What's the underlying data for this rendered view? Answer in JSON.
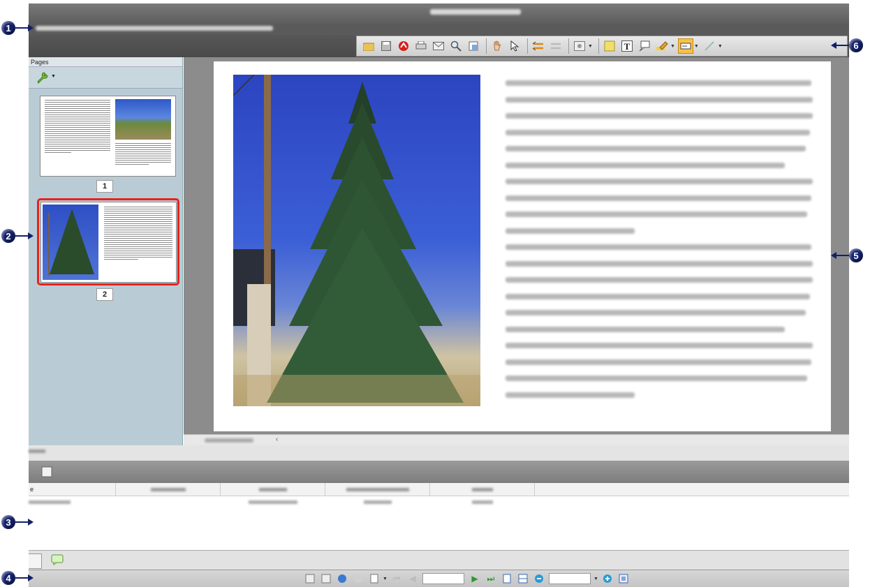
{
  "annotations": [
    {
      "num": "1",
      "label": "1"
    },
    {
      "num": "2",
      "label": "2"
    },
    {
      "num": "3",
      "label": "3"
    },
    {
      "num": "4",
      "label": "4"
    },
    {
      "num": "5",
      "label": "5"
    },
    {
      "num": "6",
      "label": "6"
    }
  ],
  "pages_panel": {
    "title": "Pages",
    "thumbnails": [
      {
        "page_number": "1",
        "selected": false
      },
      {
        "page_number": "2",
        "selected": true
      }
    ]
  },
  "bottom_panel": {
    "first_column_header": "e"
  },
  "toolbar_icons": [
    "open-folder-icon",
    "save-icon",
    "pdf-icon",
    "print-icon",
    "email-icon",
    "search-icon",
    "find-replace-icon",
    "hand-tool-icon",
    "select-tool-icon",
    "prev-view-icon",
    "next-view-icon",
    "page-options-icon",
    "note-icon",
    "text-tool-icon",
    "callout-icon",
    "highlighter-icon",
    "form-field-icon",
    "pen-icon"
  ],
  "colors": {
    "selection": "#e8211b",
    "accent": "#f7c24b",
    "marker": "#12206a"
  }
}
